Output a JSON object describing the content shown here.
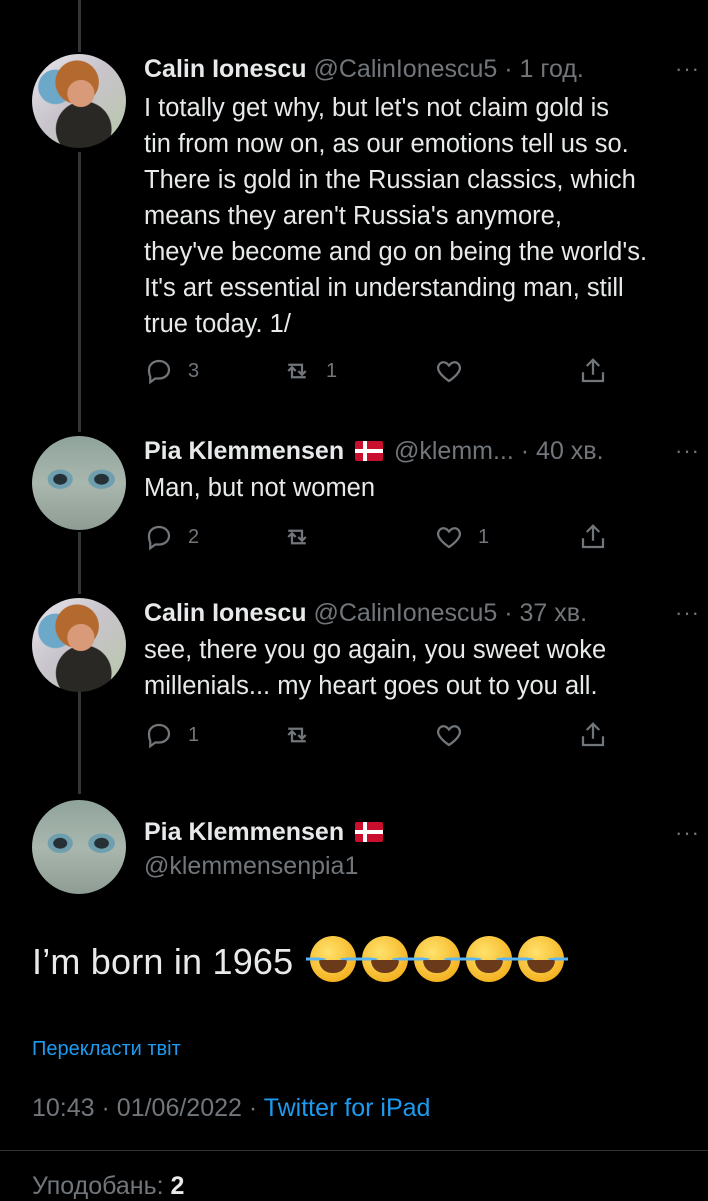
{
  "replies": [
    {
      "name": "Calin Ionescu",
      "meta": "@CalinIonescu5 · 1 год.",
      "text_lines": [
        "I totally get why, but let's not claim gold is",
        "tin from now on, as our emotions tell us so.",
        "There is gold in the Russian classics, which",
        "means they aren't Russia's anymore,",
        "they've become and go on being the world's.",
        "It's art essential in understanding man, still",
        "true today. 1/"
      ],
      "reply_count": "3",
      "retweet_count": "1",
      "like_count": ""
    },
    {
      "name": "Pia Klemmensen",
      "meta": "@klemm... · 40 хв.",
      "text_lines": [
        "Man, but not women"
      ],
      "reply_count": "2",
      "retweet_count": "",
      "like_count": "1"
    },
    {
      "name": "Calin Ionescu",
      "meta": "@CalinIonescu5 · 37 хв.",
      "text_lines": [
        "see, there you go again, you sweet woke",
        "millenials... my heart goes out to you all."
      ],
      "reply_count": "1",
      "retweet_count": "",
      "like_count": ""
    }
  ],
  "main": {
    "name": "Pia Klemmensen",
    "handle": "@klemmensenpia1",
    "text": "I’m born in 1965",
    "emoji_icons": [
      "face-with-tears-of-joy-icon",
      "face-with-tears-of-joy-icon",
      "face-with-tears-of-joy-icon",
      "face-with-tears-of-joy-icon",
      "face-with-tears-of-joy-icon"
    ],
    "translate_label": "Перекласти твіт",
    "time": "10:43",
    "date": "01/06/2022",
    "source": "Twitter for iPad",
    "likes_label": "Уподобань:",
    "likes_count": "2"
  },
  "more_label": "···",
  "colors": {
    "accent": "#1d9bf0",
    "muted": "#71767b",
    "text": "#e7e9ea",
    "background": "#000000",
    "flag_red": "#c8102e"
  }
}
